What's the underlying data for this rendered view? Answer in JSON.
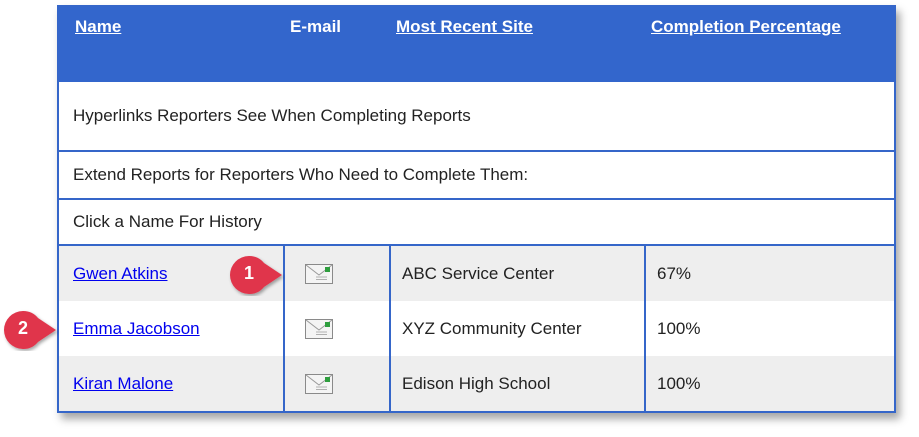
{
  "header": {
    "name": "Name",
    "email": "E-mail",
    "site": "Most Recent Site",
    "completion": "Completion Percentage"
  },
  "info_rows": [
    "Hyperlinks Reporters See When Completing Reports",
    "Extend Reports for Reporters Who Need to Complete Them:",
    "Click a Name For History"
  ],
  "reporters": [
    {
      "name": "Gwen Atkins",
      "site": "ABC Service Center",
      "completion": "67%"
    },
    {
      "name": "Emma Jacobson",
      "site": "XYZ Community Center",
      "completion": "100%"
    },
    {
      "name": "Kiran Malone",
      "site": "Edison High School",
      "completion": "100%"
    }
  ],
  "callouts": [
    "1",
    "2"
  ],
  "colors": {
    "header": "#3366cc",
    "callout": "#e0344c",
    "link": "#0000ee"
  },
  "icons": {
    "email": "envelope-icon"
  }
}
